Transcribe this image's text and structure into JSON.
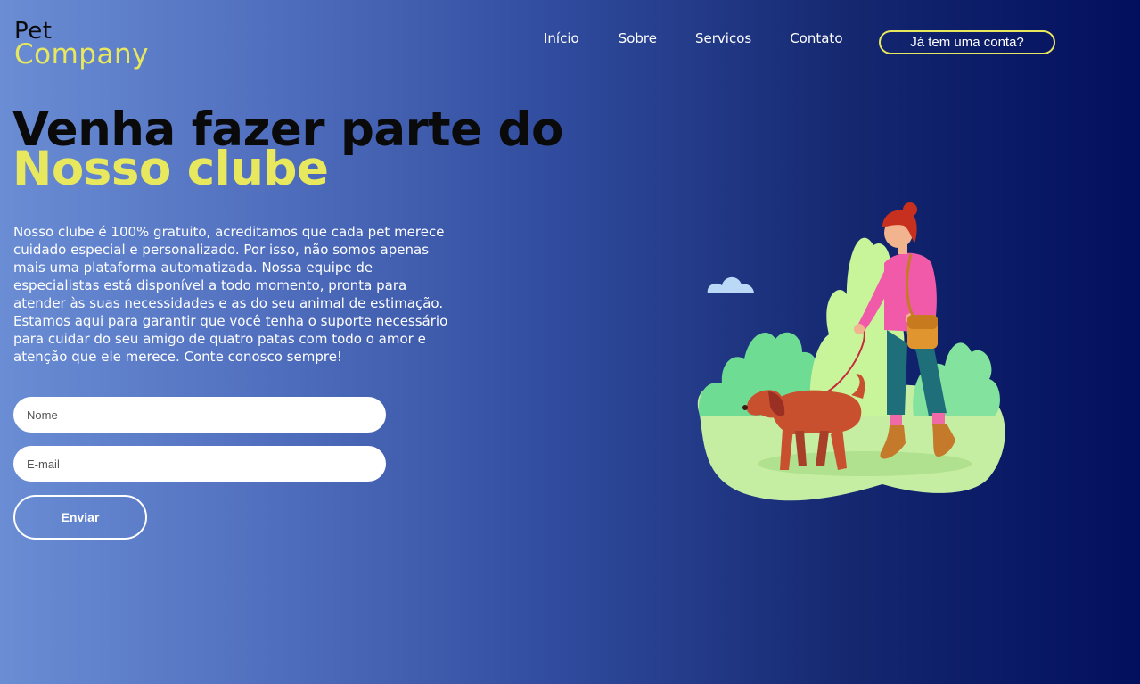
{
  "brand": {
    "line1": "Pet",
    "line2": "Company"
  },
  "nav": {
    "items": [
      "Início",
      "Sobre",
      "Serviços",
      "Contato"
    ],
    "login_label": "Já tem uma conta?"
  },
  "hero": {
    "title_line1": "Venha fazer parte do",
    "title_line2": "Nosso clube",
    "description": "Nosso clube é 100% gratuito, acreditamos que cada pet merece cuidado especial e personalizado. Por isso, não somos apenas mais uma plataforma automatizada. Nossa equipe de especialistas está disponível a todo momento, pronta para atender às suas necessidades e as do seu animal de estimação. Estamos aqui para garantir que você tenha o suporte necessário para cuidar do seu amigo de quatro patas com todo o amor e atenção que ele merece. Conte conosco sempre!"
  },
  "form": {
    "name_placeholder": "Nome",
    "name_value": "",
    "email_placeholder": "E-mail",
    "email_value": "",
    "submit_label": "Enviar"
  },
  "colors": {
    "accent": "#e8e85e",
    "gradient_start": "#6a8dd4",
    "gradient_end": "#020f5e"
  },
  "illustration": {
    "subject": "woman-walking-dog-illustration"
  }
}
